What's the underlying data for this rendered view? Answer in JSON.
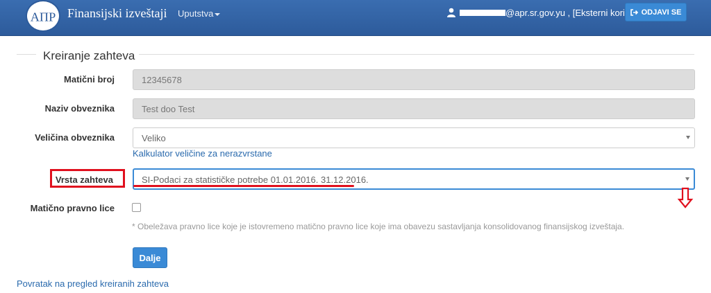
{
  "header": {
    "brand": "Finansijski izveštaji",
    "logo_letters": "AΠP",
    "menu_uputstva": "Uputstva",
    "user_suffix": "@apr.sr.gov.yu , [Eksterni korisnik]",
    "logout_label": "ODJAVI SE",
    "accent_color": "#2d5b9b"
  },
  "form": {
    "legend": "Kreiranje zahteva",
    "maticni_broj": {
      "label": "Matični broj",
      "value": "12345678"
    },
    "naziv": {
      "label": "Naziv obveznika",
      "value": "Test doo Test"
    },
    "velicina": {
      "label": "Veličina obveznika",
      "value": "Veliko"
    },
    "kalkulator_link": "Kalkulator veličine za nerazvrstane",
    "vrsta": {
      "label": "Vrsta zahteva",
      "value": "SI-Podaci za statističke potrebe 01.01.2016. 31.12.2016."
    },
    "maticno_pravno_lice": {
      "label": "Matično pravno lice",
      "checked": false
    },
    "hint": "* Obeležava pravno lice koje je istovremeno matično pravno lice koje ima obavezu sastavljanja konsolidovanog finansijskog izveštaja.",
    "submit_label": "Dalje"
  },
  "footer": {
    "back_link": "Povratak na pregled kreiranih zahteva"
  },
  "annotations": {
    "highlight_color": "#e0101e"
  }
}
